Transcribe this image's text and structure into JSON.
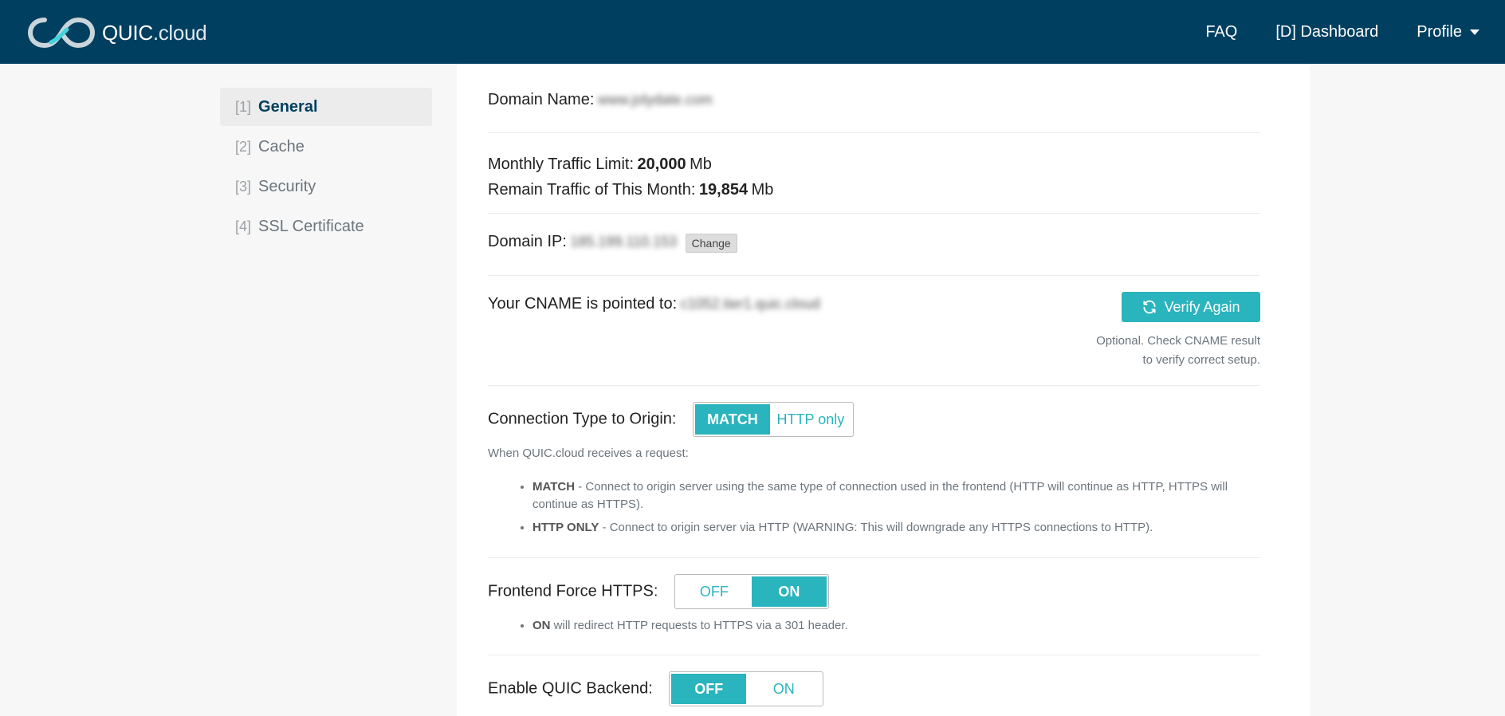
{
  "header": {
    "brand": "QUIC",
    "brand_suffix": ".cloud",
    "nav": {
      "faq": "FAQ",
      "dashboard": "[D] Dashboard",
      "profile": "Profile"
    }
  },
  "sidebar": {
    "items": [
      {
        "num": "[1]",
        "label": "General",
        "active": true
      },
      {
        "num": "[2]",
        "label": "Cache"
      },
      {
        "num": "[3]",
        "label": "Security"
      },
      {
        "num": "[4]",
        "label": "SSL Certificate"
      }
    ]
  },
  "main": {
    "domain_name_label": "Domain Name:",
    "domain_name_value": "www.jolydate.com",
    "traffic_limit_label": "Monthly Traffic Limit:",
    "traffic_limit_value": "20,000",
    "traffic_limit_unit": "Mb",
    "remain_label": "Remain Traffic of This Month:",
    "remain_value": "19,854",
    "remain_unit": "Mb",
    "domain_ip_label": "Domain IP:",
    "domain_ip_value": "185.199.110.153",
    "change_button": "Change",
    "cname_label": "Your CNAME is pointed to:",
    "cname_value": "c1052.tier1.quic.cloud",
    "verify_button": "Verify Again",
    "verify_help_line1": "Optional. Check CNAME result",
    "verify_help_line2": "to verify correct setup.",
    "connection_label": "Connection Type to Origin:",
    "connection_options": [
      "MATCH",
      "HTTP only"
    ],
    "connection_selected": "MATCH",
    "connection_intro": "When QUIC.cloud receives a request:",
    "connection_desc": [
      {
        "term": "MATCH",
        "text": " - Connect to origin server using the same type of connection used in the frontend (HTTP will continue as HTTP, HTTPS will continue as HTTPS)."
      },
      {
        "term": "HTTP ONLY",
        "text": " - Connect to origin server via HTTP (WARNING: This will downgrade any HTTPS connections to HTTP)."
      }
    ],
    "force_https_label": "Frontend Force HTTPS:",
    "force_https_options": [
      "OFF",
      "ON"
    ],
    "force_https_selected": "ON",
    "force_https_desc_term": "ON",
    "force_https_desc_text": " will redirect HTTP requests to HTTPS via a 301 header.",
    "quic_backend_label": "Enable QUIC Backend:",
    "quic_backend_options": [
      "OFF",
      "ON"
    ],
    "quic_backend_selected": "OFF"
  },
  "colors": {
    "header_bg": "#003f60",
    "accent": "#2ab4bd"
  }
}
